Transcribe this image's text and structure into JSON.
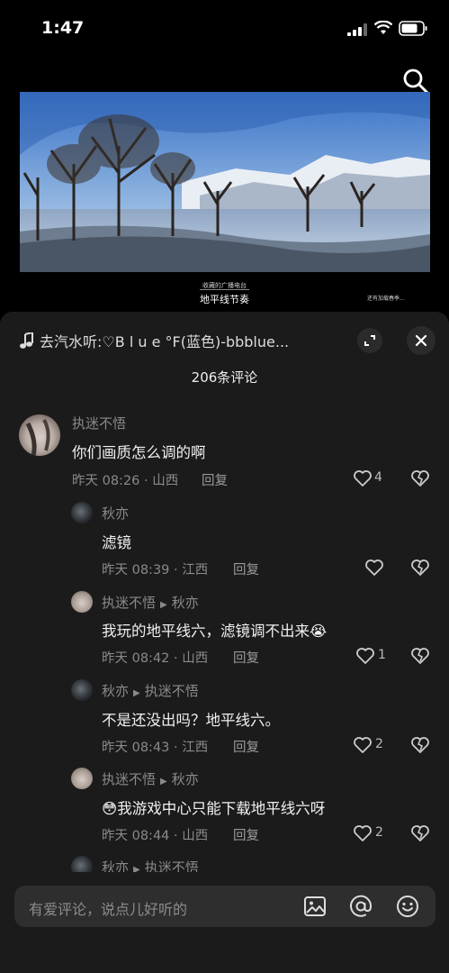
{
  "status": {
    "time": "1:47"
  },
  "video": {
    "caption_small": "收藏的广播电台",
    "caption_title": "地平线节奏",
    "caption_right": "还有加载春季..."
  },
  "panel": {
    "song_prefix": "去汽水听:",
    "song_title": "♡B l u e °F(蓝色)-bbblue...",
    "comment_count": "206条评论"
  },
  "comments": [
    {
      "user": "执迷不悟",
      "text": "你们画质怎么调的啊",
      "meta": "昨天 08:26 · 山西",
      "reply": "回复",
      "likes": "4"
    },
    {
      "user": "秋亦",
      "text": "滤镜",
      "meta": "昨天 08:39 · 江西",
      "reply": "回复",
      "likes": ""
    },
    {
      "user": "执迷不悟",
      "to": "秋亦",
      "text": "我玩的地平线六，滤镜调不出来😭",
      "meta": "昨天 08:42 · 山西",
      "reply": "回复",
      "likes": "1"
    },
    {
      "user": "秋亦",
      "to": "执迷不悟",
      "text": "不是还没出吗？地平线六。",
      "meta": "昨天 08:43 · 江西",
      "reply": "回复",
      "likes": "2"
    },
    {
      "user": "执迷不悟",
      "to": "秋亦",
      "text": "😳我游戏中心只能下载地平线六呀",
      "meta": "昨天 08:44 · 山西",
      "reply": "回复",
      "likes": "2"
    },
    {
      "user": "秋亦",
      "to": "执迷不悟"
    }
  ],
  "input": {
    "placeholder": "有爱评论，说点儿好听的"
  },
  "icons": [
    "search-icon",
    "music-note-icon",
    "expand-icon",
    "close-icon",
    "heart-icon",
    "broken-heart-icon",
    "image-icon",
    "at-icon",
    "emoji-icon"
  ]
}
